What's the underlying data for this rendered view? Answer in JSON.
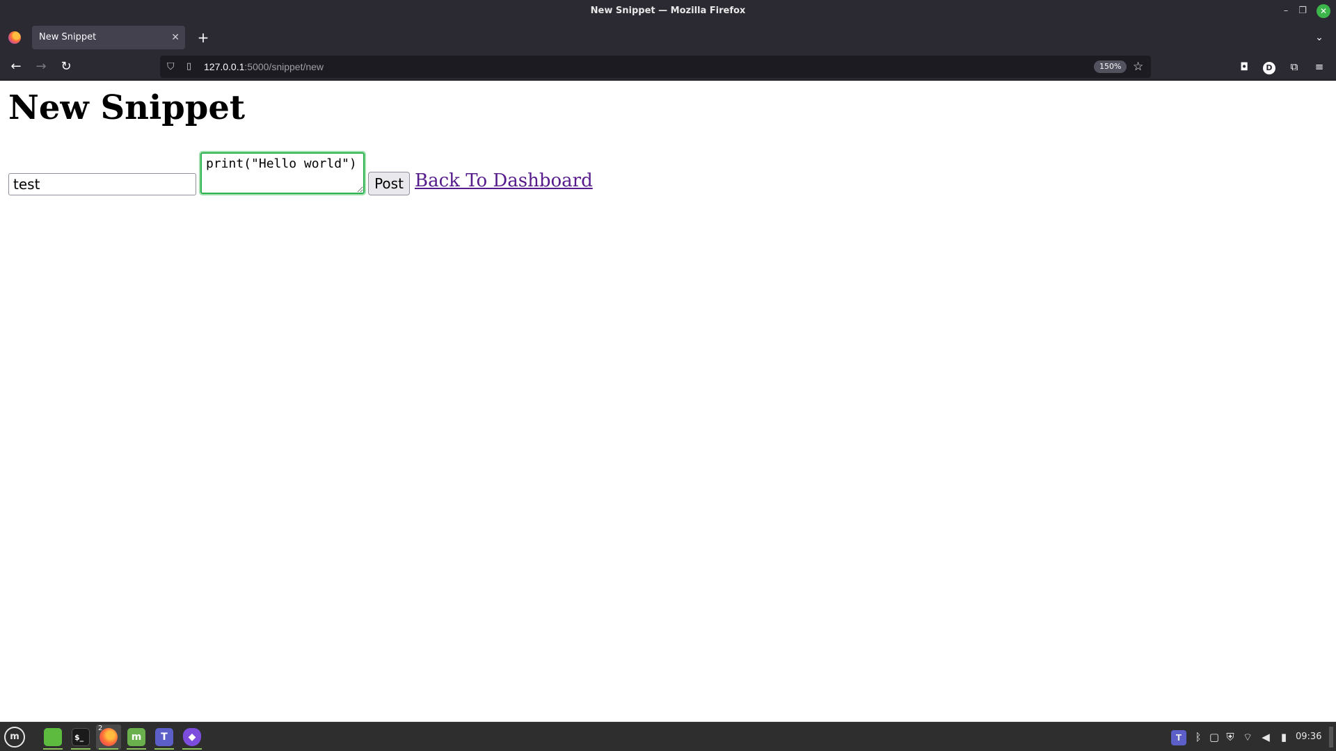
{
  "window": {
    "title": "New Snippet — Mozilla Firefox",
    "minimize": "–",
    "maximize": "❐",
    "close": "✕"
  },
  "browser": {
    "tab_title": "New Snippet",
    "tab_close": "✕",
    "new_tab": "+",
    "tab_list": "⌄",
    "url_host": "127.0.0.1",
    "url_path": ":5000/snippet/new",
    "zoom": "150%",
    "account_initial": "D",
    "icons": {
      "back": "←",
      "forward": "→",
      "reload": "↻",
      "shield": "⛉",
      "page": "▯",
      "star": "☆",
      "pocket": "◘",
      "extensions": "⧉",
      "menu": "≡"
    }
  },
  "page": {
    "heading": "New Snippet",
    "title_input_value": "test",
    "code_value": "print(\"Hello world\")",
    "post_label": "Post",
    "back_link": "Back To Dashboard"
  },
  "taskbar": {
    "menu_glyph": "m",
    "terminal_glyph": "$_",
    "firefox_badge": "2",
    "mintupdate_glyph": "m",
    "teams_glyph": "T",
    "obsidian_glyph": "◆",
    "teams_tray_glyph": "T",
    "tray_icons": {
      "bluetooth": "ᛒ",
      "clipboard": "▢",
      "shield": "⛨",
      "wifi": "⌔",
      "volume": "◀",
      "battery": "▮"
    },
    "clock": "09:36"
  },
  "colors": {
    "chrome_bg": "#2b2a33",
    "url_bg": "#1c1b22",
    "focus_green": "#2bb24c",
    "link_visited": "#551a8b",
    "taskbar_bg": "#2e2e2e"
  }
}
